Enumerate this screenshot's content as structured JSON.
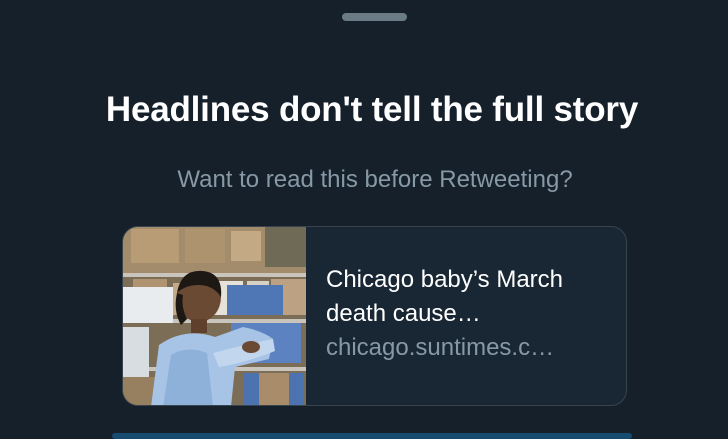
{
  "prompt": {
    "headline": "Headlines don't tell the full story",
    "subtitle": "Want to read this before Retweeting?"
  },
  "link_card": {
    "title": "Chicago baby’s March death cause…",
    "domain": "chicago.suntimes.c…",
    "thumbnail_icon": "news-photo"
  },
  "colors": {
    "background": "#15202b",
    "text_primary": "#ffffff",
    "text_secondary": "#8899a6",
    "card_border": "#38444d",
    "accent": "#1da1f2"
  }
}
